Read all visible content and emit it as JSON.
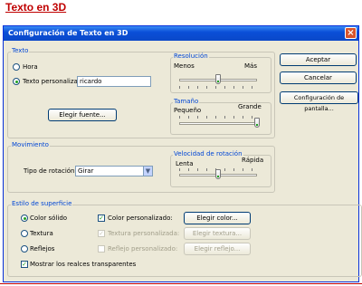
{
  "page": {
    "title": "Texto en 3D"
  },
  "dialog": {
    "title": "Configuración de Texto en 3D",
    "close_icon": "close-icon",
    "buttons": {
      "accept": "Aceptar",
      "cancel": "Cancelar",
      "screen_config": "Configuración de pantalla..."
    },
    "texto": {
      "legend": "Texto",
      "option_hora": "Hora",
      "option_custom": "Texto personalizado:",
      "custom_value": "ricardo",
      "selected": "Texto personalizado",
      "choose_font": "Elegir fuente..."
    },
    "resolucion": {
      "legend": "Resolución",
      "min_label": "Menos",
      "max_label": "Más",
      "level": 0.5
    },
    "tamano": {
      "legend": "Tamaño",
      "min_label": "Pequeño",
      "max_label": "Grande",
      "level": 1.0
    },
    "movimiento": {
      "legend": "Movimiento",
      "rotation_label": "Tipo de rotación:",
      "rotation_value": "Girar"
    },
    "velocidad": {
      "legend": "Velocidad de rotación",
      "min_label": "Lenta",
      "max_label": "Rápida",
      "level": 0.5
    },
    "superficie": {
      "legend": "Estilo de superficie",
      "option_solid": "Color sólido",
      "option_texture": "Textura",
      "option_reflections": "Reflejos",
      "selected": "Color sólido",
      "custom_color": "Color personalizado:",
      "custom_texture": "Textura personalizada:",
      "custom_reflection": "Reflejo personalizado:",
      "choose_color": "Elegir color...",
      "choose_texture": "Elegir textura...",
      "choose_reflection": "Elegir reflejo...",
      "show_highlights": "Mostrar los realces transparentes"
    }
  }
}
